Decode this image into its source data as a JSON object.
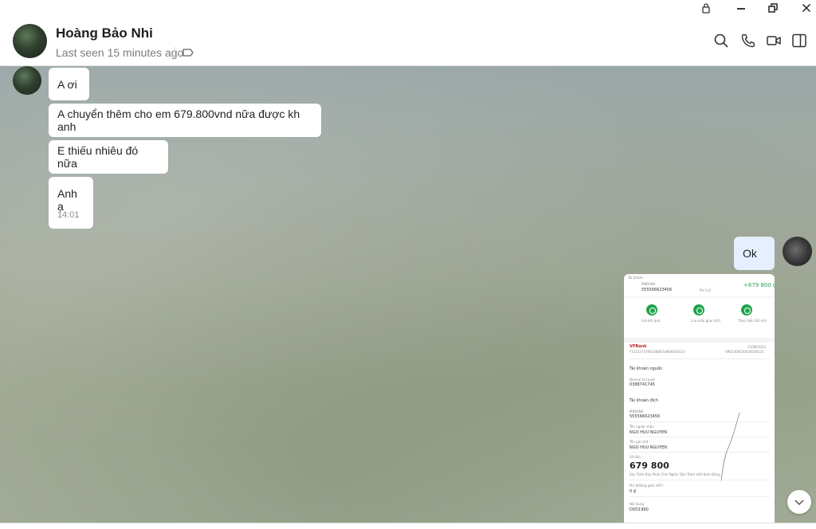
{
  "window": {
    "icons": [
      "lock-icon",
      "minimize-icon",
      "restore-icon",
      "close-icon"
    ]
  },
  "header": {
    "contact_name": "Hoàng Bảo Nhi",
    "last_seen": "Last seen 15 minutes ago",
    "icons": [
      "tag-icon",
      "search-icon",
      "phone-icon",
      "video-icon",
      "sidebar-toggle-icon"
    ]
  },
  "messages": {
    "incoming": [
      {
        "text": "A ơi"
      },
      {
        "text": "A chuyển thêm cho em 679.800vnd nữa được kh anh"
      },
      {
        "text": "E thiếu nhiêu đó nữa"
      },
      {
        "text": "Anh ạ",
        "time": "14:01"
      }
    ],
    "outgoing": [
      {
        "text": "Ok"
      }
    ]
  },
  "receipt": {
    "header_label": "Tài khoản",
    "bank": "MBBANK",
    "account": "555566623456",
    "fee": "Phí 0 ₫",
    "amount_change": "+679 800 ₫",
    "actions": [
      "Gửi kết quả",
      "Lưu mẫu giao dịch",
      "Thực hiện GD mới"
    ],
    "vpbank": "VPBank",
    "ref": "FT23227476010880/18806830131",
    "date": "15/08/2023",
    "ref2": "VPB2308150030038131",
    "source_label": "Tài khoản nguồn",
    "source_type": "Normal Account",
    "source_account": "0388741745",
    "dest_label": "Tài khoản đích",
    "dest_bank": "MBBANK",
    "dest_account": "555566623456",
    "receiver_label": "Tên người nhận",
    "receiver_name": "NGO HUU NGUYEN",
    "sender_label": "Tên gợi nhớ",
    "sender_name": "NGO HUU NGUYEN",
    "amount_label": "Số tiền",
    "amount": "679 800",
    "amount_words": "Sáu Trăm Bảy Mươi Chín Nghìn Tám Trăm Việt Nam Đồng",
    "fee_label": "Phí (Không gồm VAT)",
    "fee_value": "0 ₫",
    "content_label": "Nội dung",
    "content_value": "DVD1990"
  },
  "colors": {
    "accent_green": "#1fa54c",
    "outgoing_bubble": "#e5efff",
    "vpbank_red": "#c1272d"
  }
}
